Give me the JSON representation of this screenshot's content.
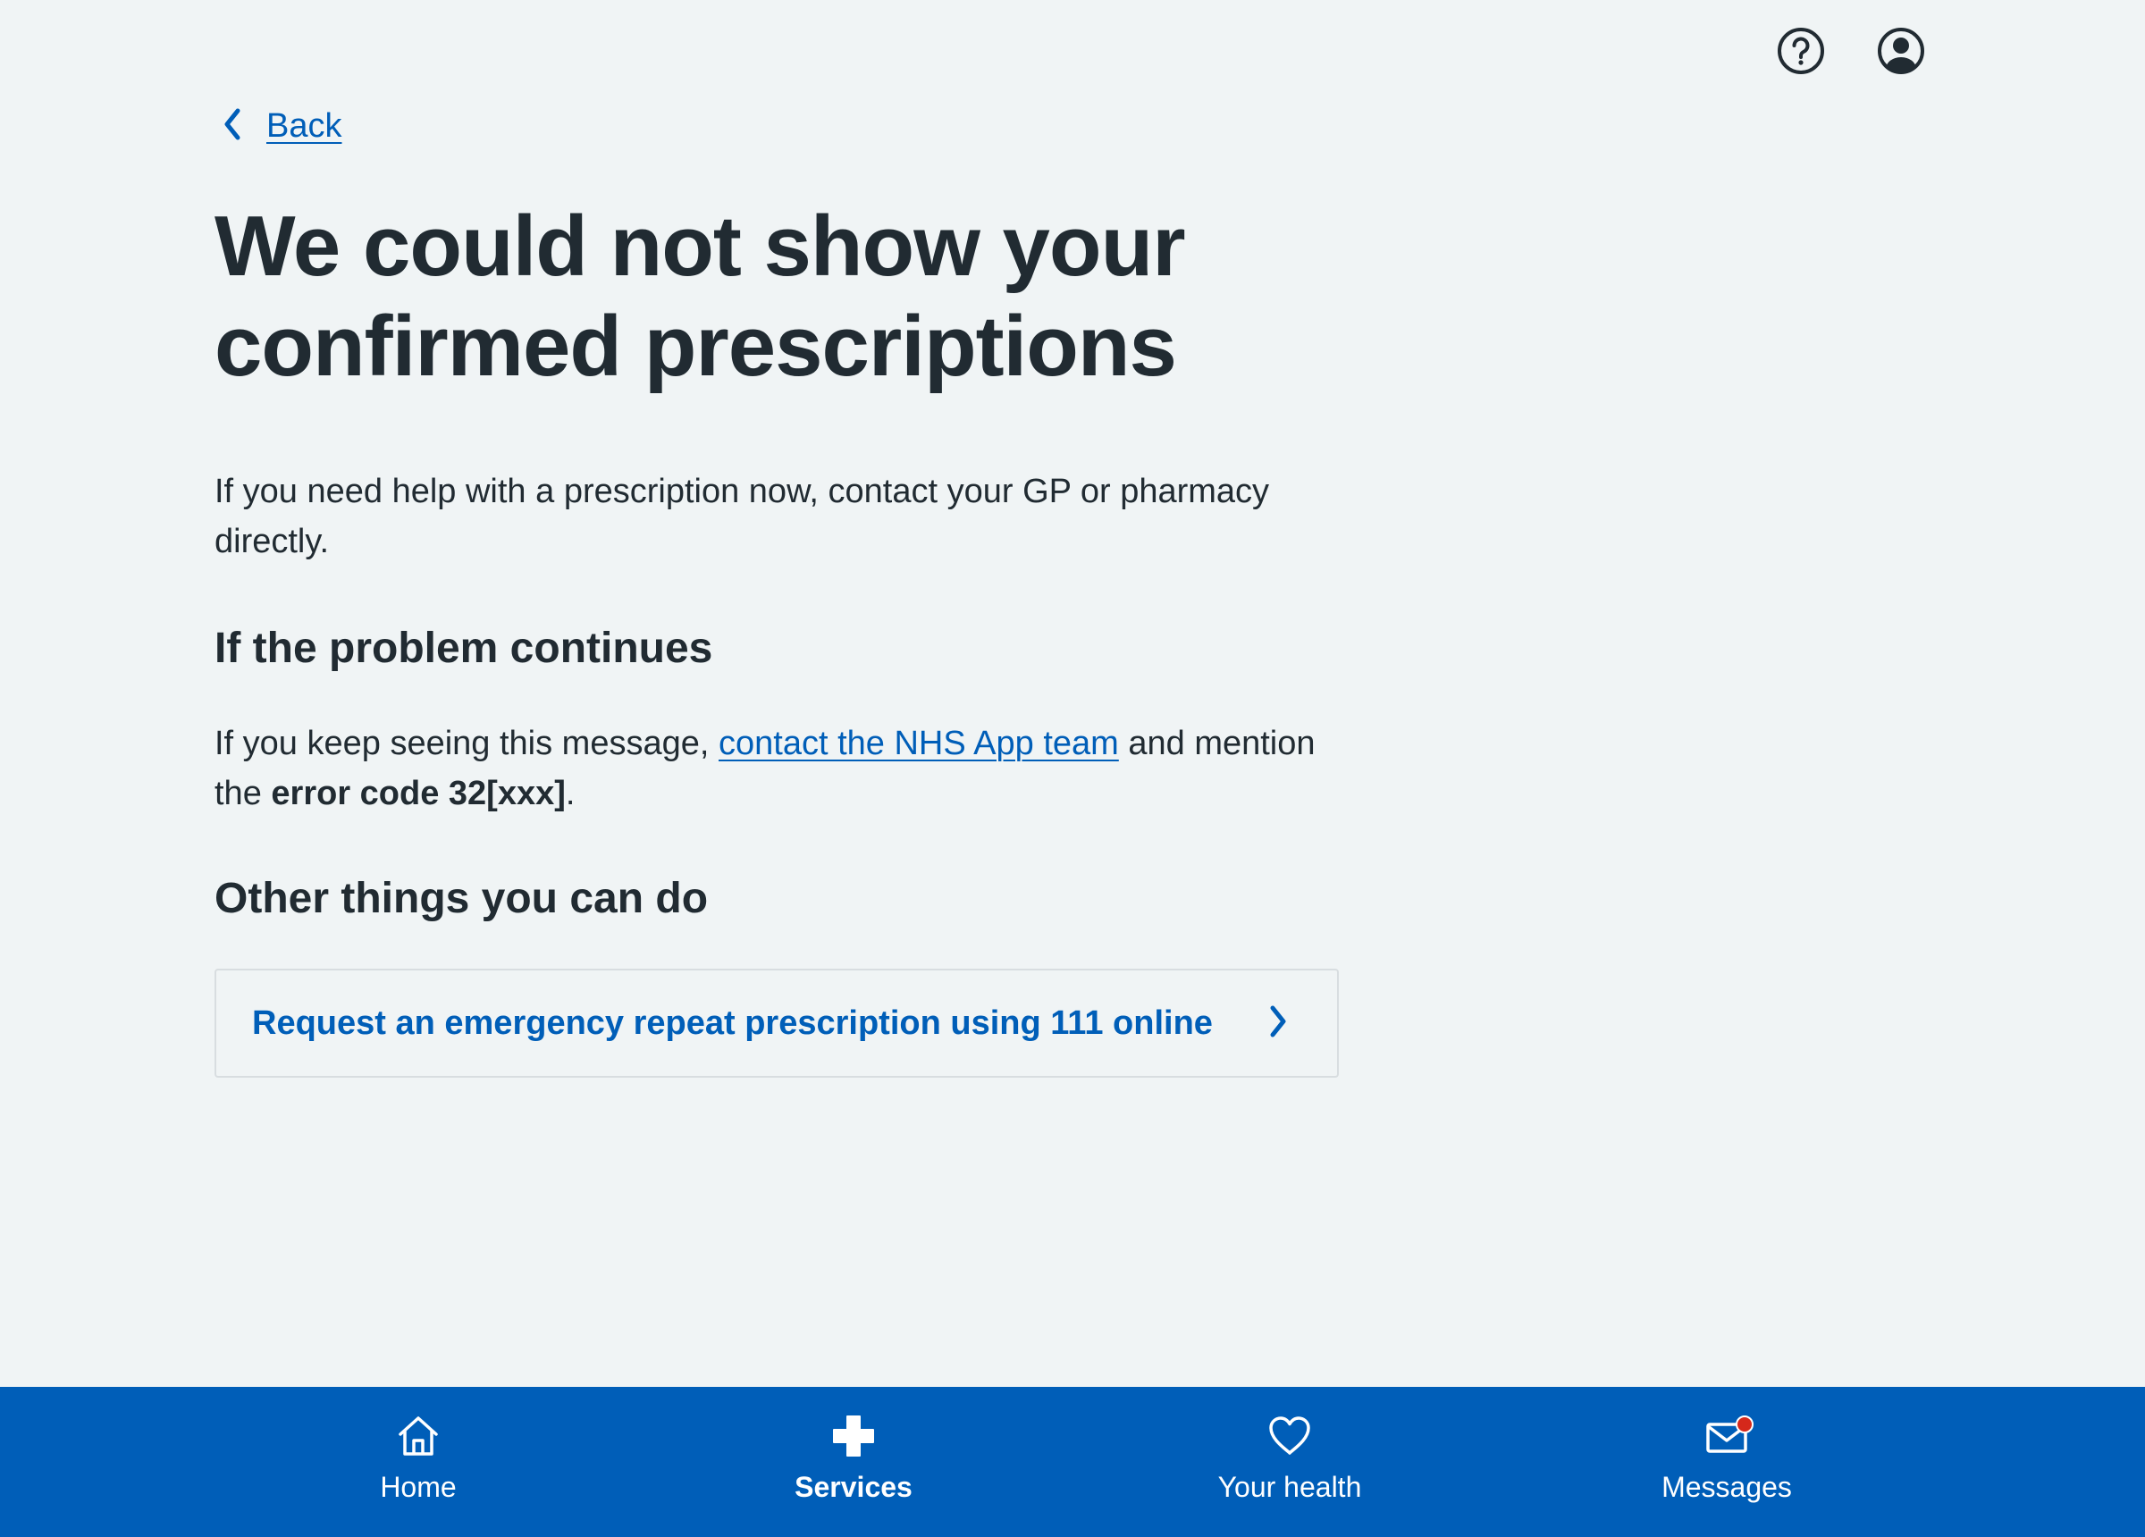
{
  "header": {
    "help_icon": "help-circle-icon",
    "account_icon": "account-icon"
  },
  "back": {
    "label": "Back",
    "icon": "chevron-left-icon"
  },
  "main": {
    "title": "We could not show your confirmed prescriptions",
    "intro": "If you need help with a prescription now, contact your GP or pharmacy directly.",
    "problem_heading": "If the problem continues",
    "problem_text_before": "If you keep seeing this message, ",
    "problem_link": "contact the NHS App team",
    "problem_text_middle": " and mention the ",
    "error_code": "error code 32[xxx]",
    "problem_text_after": ".",
    "other_heading": "Other things you can do",
    "card_link_label": "Request an emergency repeat prescription using 111 online"
  },
  "bottom_nav": {
    "items": [
      {
        "label": "Home",
        "icon": "home-icon",
        "active": false
      },
      {
        "label": "Services",
        "icon": "plus-icon",
        "active": true
      },
      {
        "label": "Your health",
        "icon": "heart-icon",
        "active": false
      },
      {
        "label": "Messages",
        "icon": "envelope-icon",
        "active": false,
        "badge": true
      }
    ]
  },
  "colors": {
    "background": "#f0f4f5",
    "text": "#212b32",
    "link": "#005eb8",
    "nav_background": "#005eb8",
    "badge": "#d5281b",
    "border": "#d8dde0"
  }
}
